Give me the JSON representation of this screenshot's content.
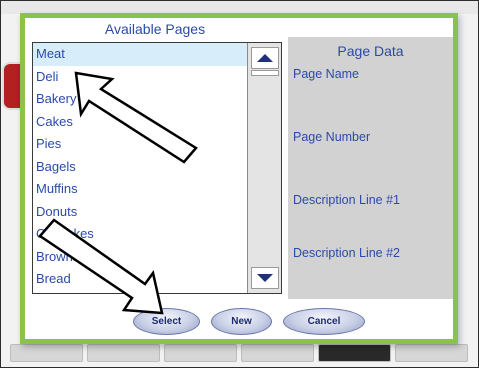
{
  "dialog": {
    "list_header": "Available Pages",
    "pages": [
      "Meat",
      "Deli",
      "Bakery",
      "Cakes",
      "Pies",
      "Bagels",
      "Muffins",
      "Donuts",
      "Cupcakes",
      "Brownies",
      "Bread"
    ],
    "selected_index": 0,
    "page_data": {
      "title": "Page Data",
      "labels": [
        "Page Name",
        "Page Number",
        "Description Line #1",
        "Description Line #2"
      ]
    },
    "buttons": {
      "select": "Select",
      "new": "New",
      "cancel": "Cancel"
    }
  },
  "colors": {
    "accent_border": "#8bc34a",
    "text_blue": "#2b4aa8",
    "panel_gray": "#d2d2d2"
  },
  "icons": [
    "scroll-up-icon",
    "scroll-down-icon",
    "arrow-callout-icon"
  ]
}
